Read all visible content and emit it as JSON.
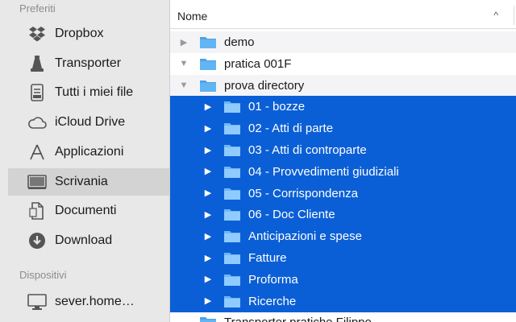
{
  "sidebar": {
    "favorites_title": "Preferiti",
    "favorites": [
      {
        "label": "Dropbox",
        "icon": "dropbox-icon"
      },
      {
        "label": "Transporter",
        "icon": "transporter-icon"
      },
      {
        "label": "Tutti i miei file",
        "icon": "all-files-icon"
      },
      {
        "label": "iCloud Drive",
        "icon": "cloud-icon"
      },
      {
        "label": "Applicazioni",
        "icon": "applications-icon"
      },
      {
        "label": "Scrivania",
        "icon": "desktop-icon",
        "selected": true
      },
      {
        "label": "Documenti",
        "icon": "documents-icon"
      },
      {
        "label": "Download",
        "icon": "download-icon"
      }
    ],
    "devices_title": "Dispositivi",
    "devices": [
      {
        "label": "sever.home…",
        "icon": "computer-icon"
      }
    ]
  },
  "list": {
    "header_name": "Nome",
    "sort_icon": "sort-ascending-icon",
    "rows": [
      {
        "label": "demo",
        "disclosure": "▶",
        "level": 0
      },
      {
        "label": "pratica 001F",
        "disclosure": "▼",
        "level": 0
      },
      {
        "label": "prova directory",
        "disclosure": "▼",
        "level": 0
      },
      {
        "label": "01 - bozze",
        "disclosure": "▶",
        "level": 1,
        "selected": true
      },
      {
        "label": "02 - Atti di parte",
        "disclosure": "▶",
        "level": 1,
        "selected": true
      },
      {
        "label": "03 - Atti di controparte",
        "disclosure": "▶",
        "level": 1,
        "selected": true
      },
      {
        "label": "04 - Provvedimenti giudiziali",
        "disclosure": "▶",
        "level": 1,
        "selected": true
      },
      {
        "label": "05 - Corrispondenza",
        "disclosure": "▶",
        "level": 1,
        "selected": true
      },
      {
        "label": "06 - Doc Cliente",
        "disclosure": "▶",
        "level": 1,
        "selected": true
      },
      {
        "label": "Anticipazioni e spese",
        "disclosure": "▶",
        "level": 1,
        "selected": true
      },
      {
        "label": "Fatture",
        "disclosure": "▶",
        "level": 1,
        "selected": true
      },
      {
        "label": "Proforma",
        "disclosure": "▶",
        "level": 1,
        "selected": true
      },
      {
        "label": "Ricerche",
        "disclosure": "▶",
        "level": 1,
        "selected": true
      },
      {
        "label": "Transporter pratiche Filippo",
        "disclosure": "",
        "level": 0
      }
    ]
  },
  "colors": {
    "selection": "#0b5fd6",
    "folder": "#63b4f2",
    "folder_selected": "#8fcbff",
    "sidebar_bg": "#e8e8e8"
  }
}
